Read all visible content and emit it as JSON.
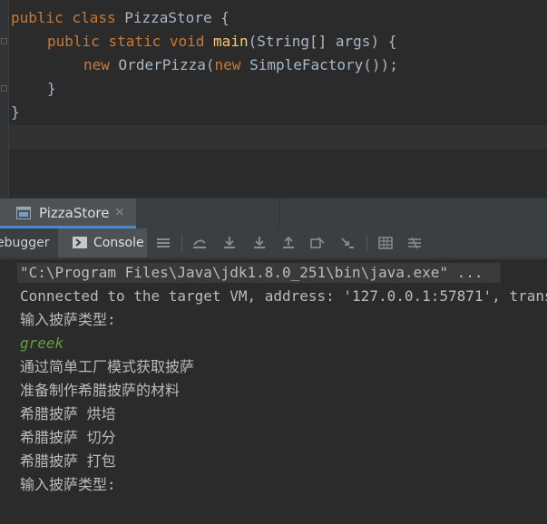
{
  "editor": {
    "lines": [
      {
        "kw1": "public",
        "kw2": "class",
        "name": "PizzaStore",
        "brace": "{"
      },
      {
        "kw1": "public",
        "kw2": "static",
        "kw3": "void",
        "method": "main",
        "params": "(String[] args) {"
      },
      {
        "kw": "new",
        "pre": "OrderPizza(",
        "kw_inner": "new",
        "post": "SimpleFactory());"
      },
      {
        "text": "}"
      },
      {
        "text": "}"
      }
    ]
  },
  "run_panel": {
    "tab": {
      "label": "PizzaStore",
      "close": "×",
      "icon": "run-window-icon"
    },
    "toolbar": {
      "debugger_label": "ebugger",
      "console_label": "Console",
      "icons": [
        "menu-icon",
        "show-execution-point-icon",
        "step-over-icon",
        "step-into-icon",
        "force-step-into-icon",
        "step-out-icon",
        "drop-frame-icon",
        "run-to-cursor-icon",
        "evaluate-expression-icon",
        "trace-icon"
      ]
    }
  },
  "console": {
    "lines": [
      "\"C:\\Program Files\\Java\\jdk1.8.0_251\\bin\\java.exe\" ...",
      "Connected to the target VM, address: '127.0.0.1:57871', transport: 'socket'",
      "输入披萨类型:",
      "greek",
      "通过简单工厂模式获取披萨",
      "准备制作希腊披萨的材料",
      "希腊披萨 烘培",
      "希腊披萨 切分",
      "希腊披萨 打包",
      "输入披萨类型:"
    ]
  },
  "colors": {
    "keyword": "#cc7832",
    "method": "#ffc66d",
    "plain": "#a9b7c6",
    "console_text": "#bbbbbb",
    "user_input": "#62a03e",
    "accent": "#4a88c7"
  }
}
